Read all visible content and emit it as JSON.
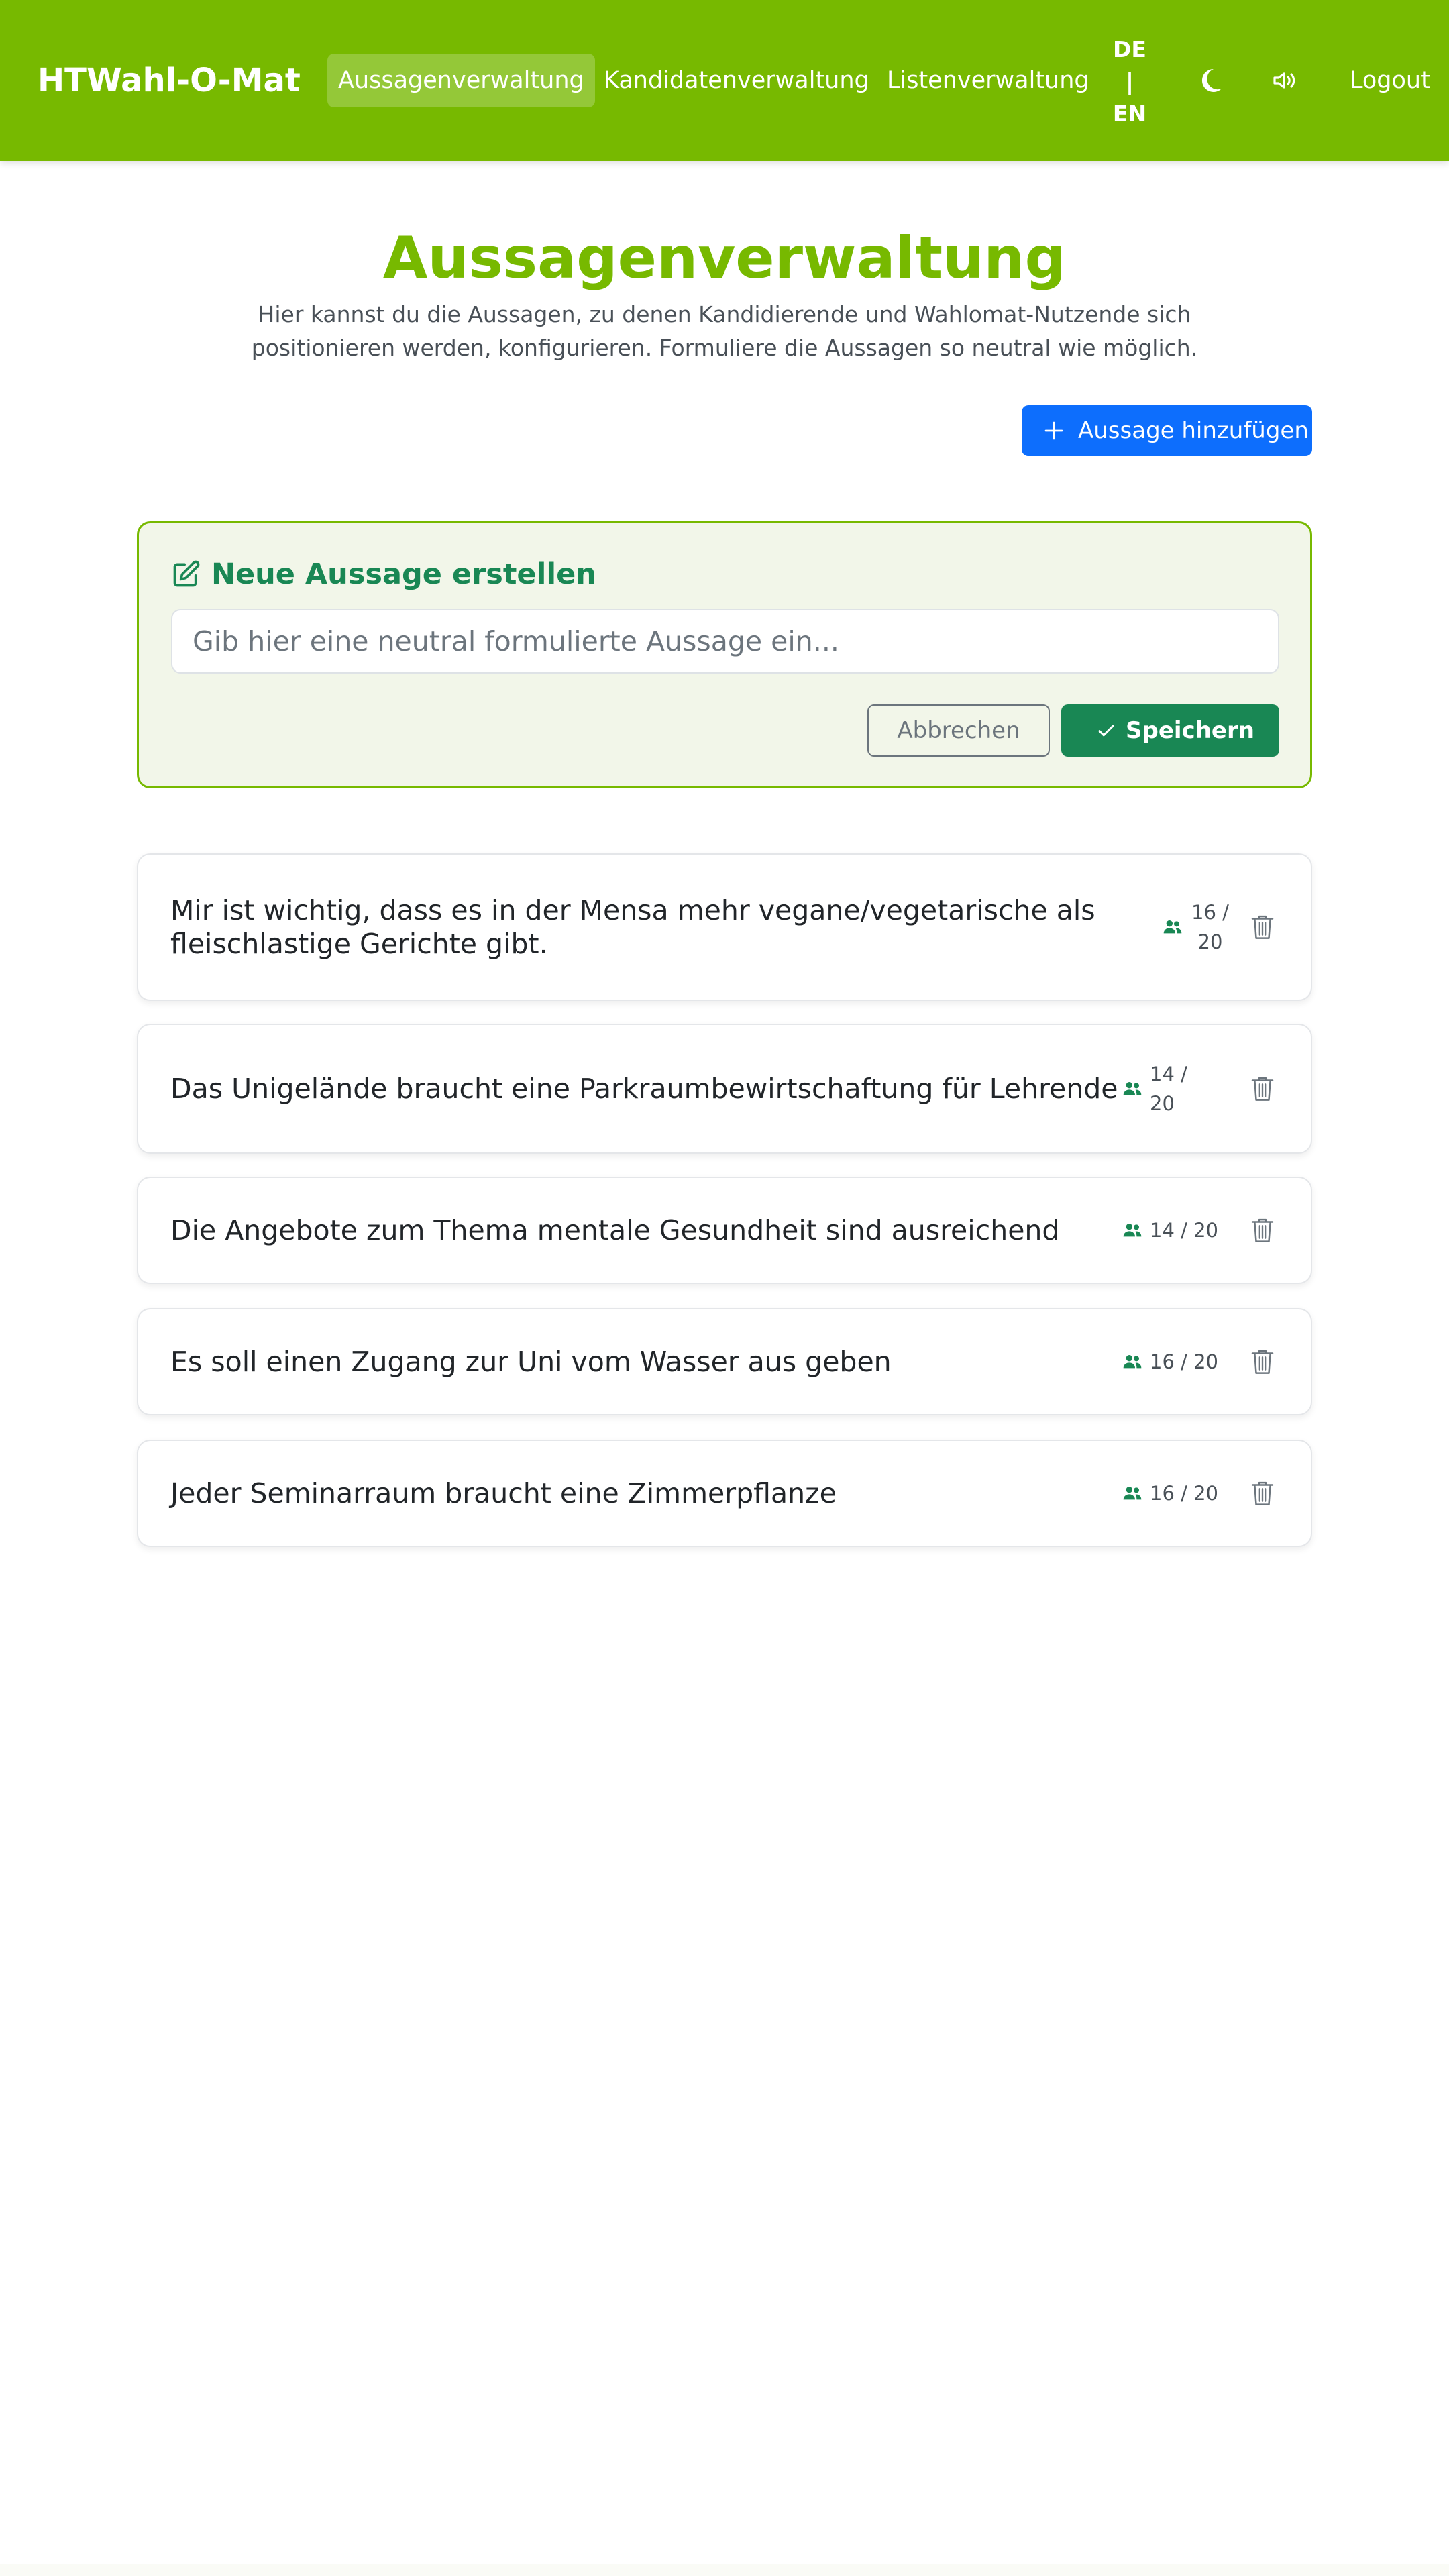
{
  "nav": {
    "brand": "HTWahl-O-Mat",
    "links": [
      {
        "label": "Aussagenverwaltung",
        "active": true
      },
      {
        "label": "Kandidatenverwaltung",
        "active": false
      },
      {
        "label": "Listenverwaltung",
        "active": false
      }
    ],
    "lang": {
      "de": "DE",
      "sep": "|",
      "en": "EN"
    },
    "icons": [
      "moon-icon",
      "volume-icon"
    ],
    "logout": "Logout"
  },
  "page": {
    "title": "Aussagenverwaltung",
    "description": "Hier kannst du die Aussagen, zu denen Kandidierende und Wahlomat-Nutzende sich positionieren werden, konfigurieren. Formuliere die Aussagen so neutral wie möglich.",
    "add_button": "Aussage hinzufügen"
  },
  "new_statement": {
    "title": "Neue Aussage erstellen",
    "placeholder": "Gib hier eine neutral formulierte Aussage ein...",
    "value": "",
    "cancel": "Abbrechen",
    "save": "Speichern"
  },
  "statements": [
    {
      "text": "Mir ist wichtig, dass es in der Mensa mehr vegane/vegetarische als fleischlastige Gerichte gibt.",
      "answered": 16,
      "total": 20,
      "count": "16 / 20"
    },
    {
      "text": "Das Unigelände braucht eine Parkraumbewirtschaftung für Lehrende",
      "answered": 14,
      "total": 20,
      "count": "14 / 20"
    },
    {
      "text": "Die Angebote zum Thema mentale Gesundheit sind ausreichend",
      "answered": 14,
      "total": 20,
      "count": "14 / 20"
    },
    {
      "text": "Es soll einen Zugang zur Uni vom Wasser aus geben",
      "answered": 16,
      "total": 20,
      "count": "16 / 20"
    },
    {
      "text": "Jeder Seminarraum braucht eine Zimmerpflanze",
      "answered": 16,
      "total": 20,
      "count": "16 / 20"
    }
  ],
  "colors": {
    "brand_green": "#77b900",
    "primary_blue": "#0d6efd",
    "success_green": "#198754"
  }
}
